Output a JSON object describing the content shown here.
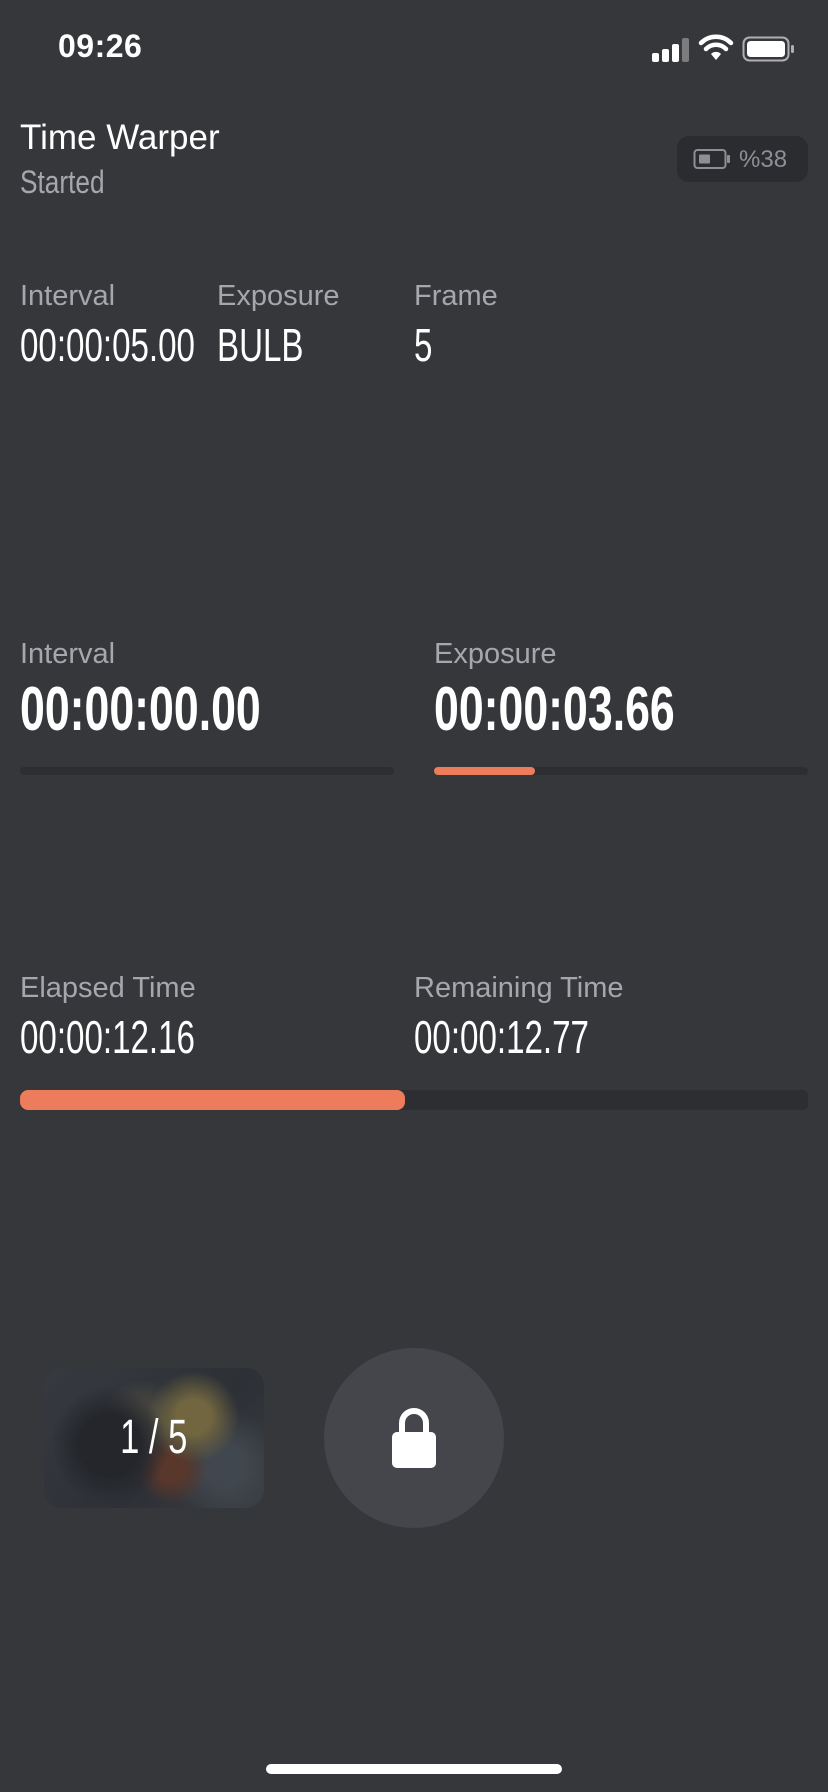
{
  "status_bar": {
    "time": "09:26",
    "icons": [
      "cellular-signal-icon",
      "wifi-icon",
      "battery-icon"
    ]
  },
  "header": {
    "title": "Time Warper",
    "status": "Started",
    "device_battery": {
      "icon": "battery-outline-icon",
      "text": "%38",
      "level": 0.38
    }
  },
  "settings": [
    {
      "label": "Interval",
      "value": "00:00:05.00"
    },
    {
      "label": "Exposure",
      "value": "BULB"
    },
    {
      "label": "Frame",
      "value": "5"
    }
  ],
  "countdowns": {
    "interval": {
      "label": "Interval",
      "value": "00:00:00.00",
      "progress": 0.0
    },
    "exposure": {
      "label": "Exposure",
      "value": "00:00:03.66",
      "progress": 0.27
    }
  },
  "timing": {
    "elapsed": {
      "label": "Elapsed Time",
      "value": "00:00:12.16"
    },
    "remaining": {
      "label": "Remaining Time",
      "value": "00:00:12.77"
    },
    "progress": 0.488
  },
  "controls": {
    "frame_counter": "1 / 5",
    "lock_icon": "lock-icon"
  },
  "colors": {
    "background": "#36373b",
    "accent": "#ec7c5c",
    "muted_text": "#a6a7ad",
    "track": "#2d2e32"
  }
}
